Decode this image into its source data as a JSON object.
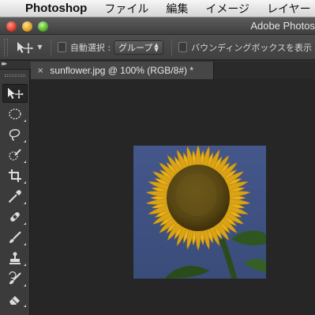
{
  "menubar": {
    "app_name": "Photoshop",
    "items": [
      "ファイル",
      "編集",
      "イメージ",
      "レイヤー"
    ]
  },
  "window": {
    "title": "Adobe Photos"
  },
  "options_bar": {
    "auto_select_label": "自動選択 :",
    "auto_select_checked": false,
    "auto_select_target": "グループ",
    "bounding_box_label": "バウンディングボックスを表示",
    "bounding_box_checked": false
  },
  "document_tab": {
    "close_symbol": "×",
    "title": "sunflower.jpg @ 100% (RGB/8#) *"
  },
  "tools": [
    {
      "name": "move-tool",
      "active": true
    },
    {
      "name": "elliptical-marquee-tool",
      "active": false
    },
    {
      "name": "lasso-tool",
      "active": false
    },
    {
      "name": "quick-selection-tool",
      "active": false
    },
    {
      "name": "crop-tool",
      "active": false
    },
    {
      "name": "eyedropper-tool",
      "active": false
    },
    {
      "name": "spot-healing-brush-tool",
      "active": false
    },
    {
      "name": "brush-tool",
      "active": false
    },
    {
      "name": "clone-stamp-tool",
      "active": false
    },
    {
      "name": "history-brush-tool",
      "active": false
    },
    {
      "name": "eraser-tool",
      "active": false
    }
  ],
  "colors": {
    "menubar_bg": "#e8e8e8",
    "workspace_bg": "#262626",
    "panel_bg": "#3b3b3b",
    "image_sky": "#3f5383",
    "petal": "#e8b21c",
    "disc": "#5c4a14"
  }
}
